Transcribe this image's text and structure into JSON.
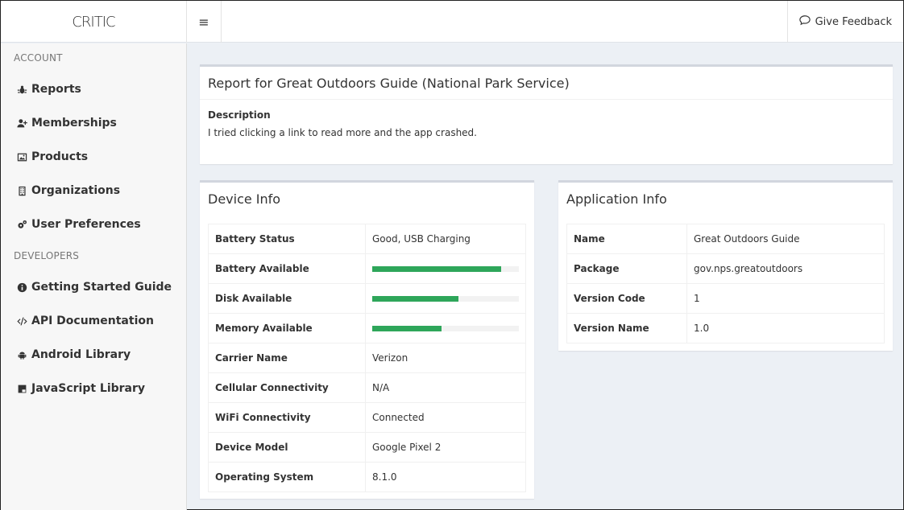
{
  "app": {
    "brand": "CRITIC",
    "menu_icon": "hamburger-icon",
    "feedback_label": "Give Feedback",
    "feedback_icon": "speech-bubble-icon"
  },
  "sidebar": {
    "account_header": "ACCOUNT",
    "account_items": [
      {
        "label": "Reports",
        "icon": "bug-icon"
      },
      {
        "label": "Memberships",
        "icon": "user-plus-icon"
      },
      {
        "label": "Products",
        "icon": "image-icon"
      },
      {
        "label": "Organizations",
        "icon": "building-icon"
      },
      {
        "label": "User Preferences",
        "icon": "cogs-icon"
      }
    ],
    "developers_header": "DEVELOPERS",
    "developer_items": [
      {
        "label": "Getting Started Guide",
        "icon": "info-circle-icon"
      },
      {
        "label": "API Documentation",
        "icon": "code-icon"
      },
      {
        "label": "Android Library",
        "icon": "android-icon"
      },
      {
        "label": "JavaScript Library",
        "icon": "js-icon"
      }
    ]
  },
  "report": {
    "title": "Report for Great Outdoors Guide (National Park Service)",
    "description_label": "Description",
    "description": "I tried clicking a link to read more and the app crashed."
  },
  "device": {
    "title": "Device Info",
    "rows": [
      {
        "key": "Battery Status",
        "value": "Good, USB Charging"
      },
      {
        "key": "Battery Available",
        "level": 0.88
      },
      {
        "key": "Disk Available",
        "level": 0.59
      },
      {
        "key": "Memory Available",
        "level": 0.47
      },
      {
        "key": "Carrier Name",
        "value": "Verizon"
      },
      {
        "key": "Cellular Connectivity",
        "value": "N/A"
      },
      {
        "key": "WiFi Connectivity",
        "value": "Connected"
      },
      {
        "key": "Device Model",
        "value": "Google Pixel 2"
      },
      {
        "key": "Operating System",
        "value": "8.1.0"
      }
    ]
  },
  "application": {
    "title": "Application Info",
    "rows": [
      {
        "key": "Name",
        "value": "Great Outdoors Guide"
      },
      {
        "key": "Package",
        "value": "gov.nps.greatoutdoors"
      },
      {
        "key": "Version Code",
        "value": "1"
      },
      {
        "key": "Version Name",
        "value": "1.0"
      }
    ]
  },
  "colors": {
    "progress_fill": "#2ea65a",
    "page_bg": "#ecf0f5"
  }
}
